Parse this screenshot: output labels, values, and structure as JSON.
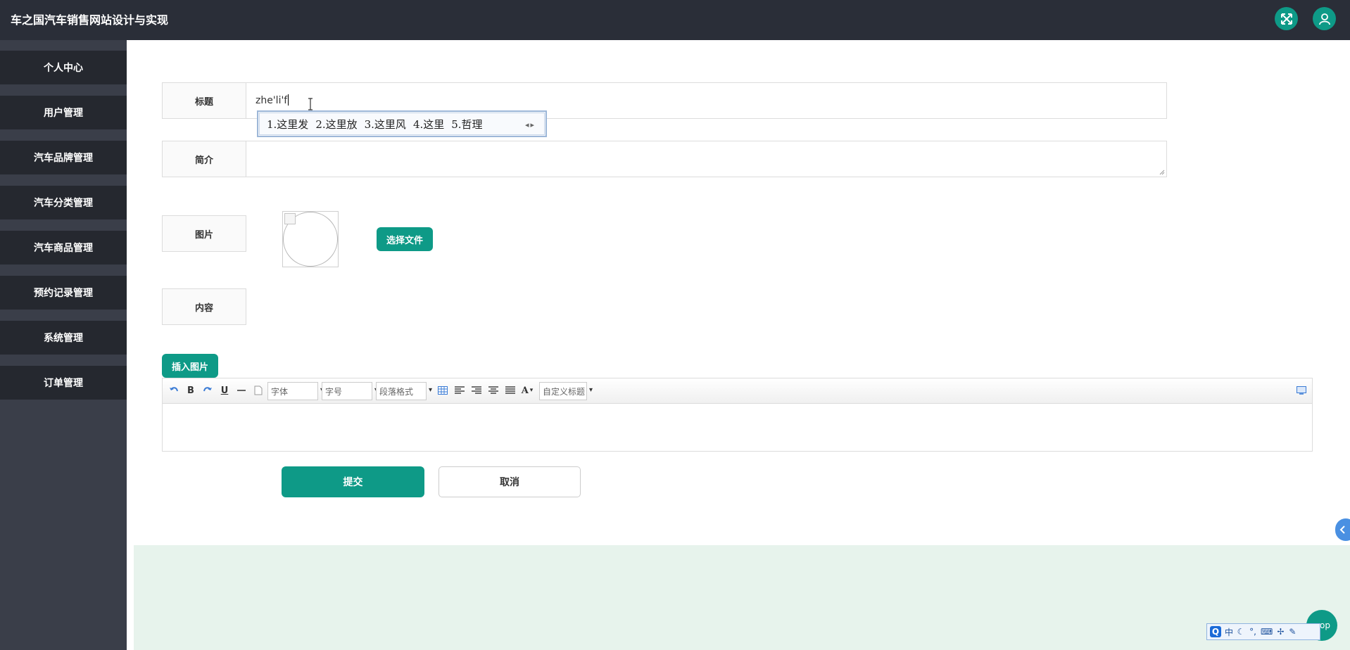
{
  "app": {
    "title": "车之国汽车销售网站设计与实现"
  },
  "header": {
    "fullscreen_icon": "expand-arrows-icon",
    "user_icon": "user-icon"
  },
  "sidebar": {
    "items": [
      {
        "label": "个人中心"
      },
      {
        "label": "用户管理"
      },
      {
        "label": "汽车品牌管理"
      },
      {
        "label": "汽车分类管理"
      },
      {
        "label": "汽车商品管理"
      },
      {
        "label": "预约记录管理"
      },
      {
        "label": "系统管理"
      },
      {
        "label": "订单管理"
      }
    ]
  },
  "form": {
    "title_label": "标题",
    "title_value": "zhe'li'f",
    "summary_label": "简介",
    "summary_value": "",
    "image_label": "图片",
    "choose_file_label": "选择文件",
    "content_label": "内容",
    "insert_image_label": "插入图片",
    "submit_label": "提交",
    "cancel_label": "取消"
  },
  "ime": {
    "candidates": [
      "1.这里发",
      "2.这里放",
      "3.这里风",
      "4.这里",
      "5.哲理"
    ],
    "status_mode": "中"
  },
  "editor": {
    "bold_label": "B",
    "underline_label": "U",
    "font_family": "字体",
    "font_size": "字号",
    "paragraph_format": "段落格式",
    "font_color_label": "A",
    "custom_heading": "自定义标题"
  },
  "float": {
    "top_label": "op"
  },
  "colors": {
    "accent": "#0e9a87",
    "topbar": "#2a2e38",
    "sidebar": "#3a3e49",
    "menu_item": "#25282f"
  }
}
